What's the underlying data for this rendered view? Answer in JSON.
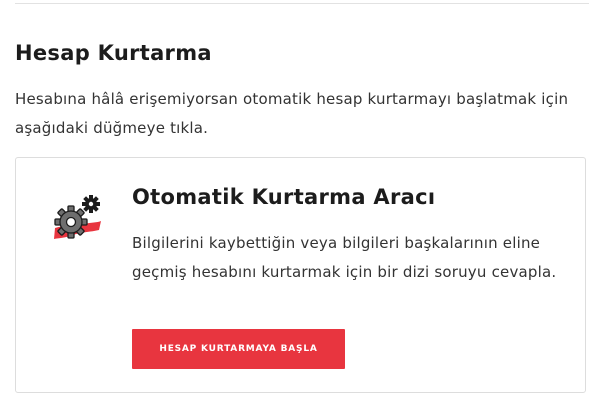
{
  "section": {
    "title": "Hesap Kurtarma",
    "description": "Hesabına hâlâ erişemiyorsan otomatik hesap kurtarmayı başlatmak için aşağıdaki düğmeye tıkla."
  },
  "card": {
    "icon": "gears-icon",
    "title": "Otomatik Kurtarma Aracı",
    "description": "Bilgilerini kaybettiğin veya bilgileri başkalarının eline geçmiş hesabını kurtarmak için bir dizi soruyu cevapla.",
    "button_label": "HESAP KURTARMAYA BAŞLA"
  },
  "colors": {
    "accent": "#e8353f",
    "text": "#1c1c1c",
    "border": "#dddddd"
  }
}
